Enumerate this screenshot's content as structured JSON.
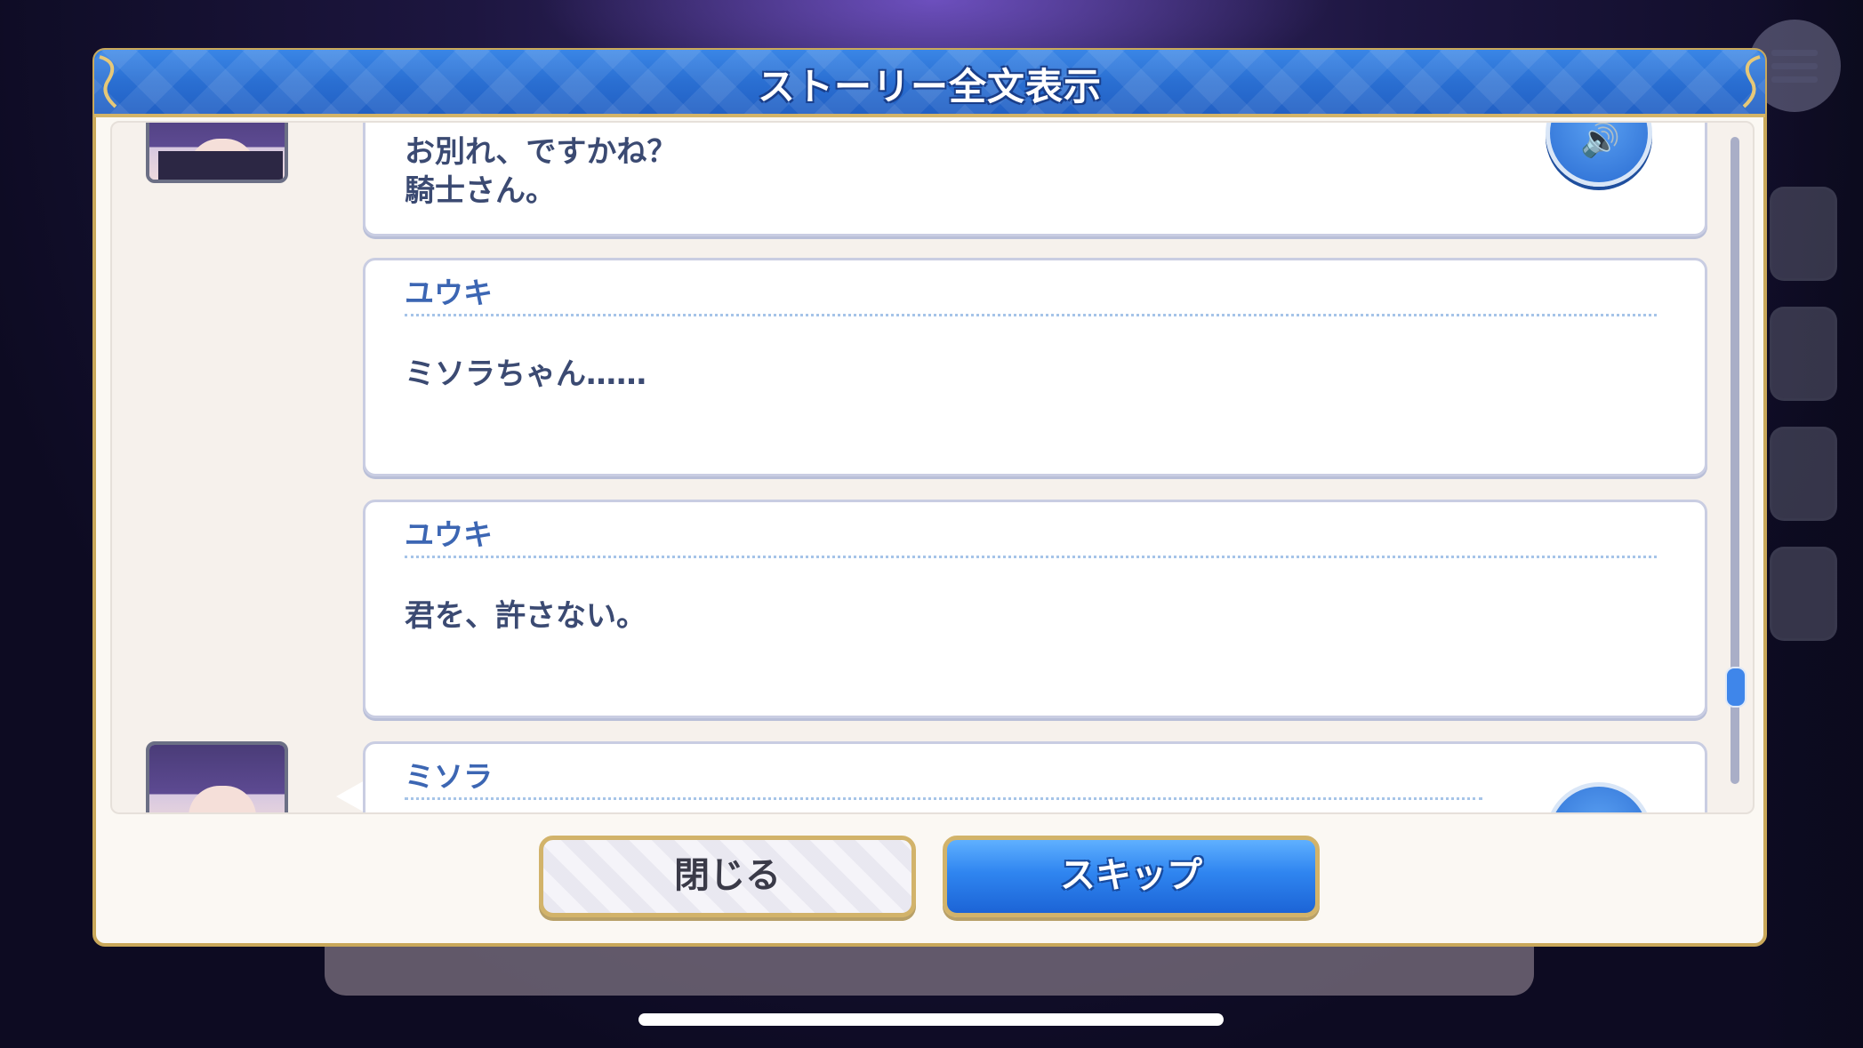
{
  "window": {
    "title": "ストーリー全文表示"
  },
  "log": [
    {
      "speaker": "",
      "text": "お別れ、ですかね？\n騎士さん。",
      "has_avatar": true,
      "has_voice": true
    },
    {
      "speaker": "ユウキ",
      "text": "ミソラちゃん……",
      "has_avatar": false,
      "has_voice": false
    },
    {
      "speaker": "ユウキ",
      "text": "君を、許さない。",
      "has_avatar": false,
      "has_voice": false
    },
    {
      "speaker": "ミソラ",
      "text": "",
      "has_avatar": true,
      "has_voice": true
    }
  ],
  "icons": {
    "voice": "speaker-icon",
    "menu": "hamburger-menu-icon"
  },
  "buttons": {
    "close_label": "閉じる",
    "skip_label": "スキップ"
  },
  "colors": {
    "header_blue": "#2a6fd2",
    "gold_border": "#c9a85a",
    "speaker_name": "#3c66b3",
    "skip_button": "#2f85f0"
  }
}
